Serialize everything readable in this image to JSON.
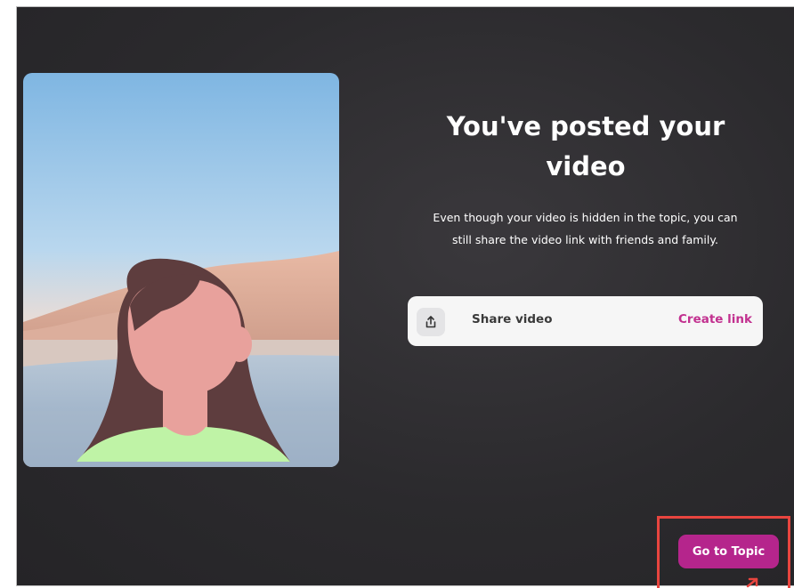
{
  "dialog": {
    "title": "You've posted your video",
    "description": "Even though your video is hidden in the topic, you can still share the video link with friends and family."
  },
  "share": {
    "icon": "share-upload-icon",
    "label": "Share video",
    "action_label": "Create link"
  },
  "footer": {
    "go_to_topic_label": "Go to Topic"
  },
  "colors": {
    "background": "#2b2a2d",
    "accent": "#b5258c",
    "link": "#c2308f",
    "highlight": "#e8453f"
  }
}
